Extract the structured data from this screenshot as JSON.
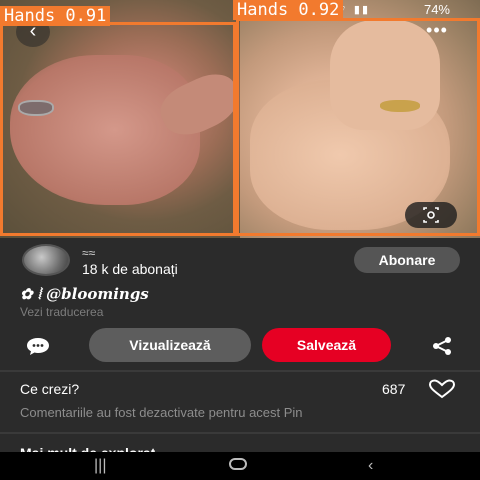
{
  "status": {
    "battery": "74%"
  },
  "detections": [
    {
      "label": "Hands 0.91"
    },
    {
      "label": "Hands 0.92"
    }
  ],
  "profile": {
    "name": "≈≈",
    "subscribers": "18 k de abonați",
    "subscribe_label": "Abonare"
  },
  "pin": {
    "handle": "✿ ⦚ @bloomings",
    "translate": "Vezi traducerea"
  },
  "actions": {
    "view_label": "Vizualizează",
    "save_label": "Salvează"
  },
  "engagement": {
    "prompt": "Ce crezi?",
    "likes": "687",
    "comments_disabled": "Comentariile au fost dezactivate pentru acest Pin",
    "more_to_explore": "Mai mult de explorat"
  },
  "colors": {
    "accent": "#e60023",
    "detection": "#f27a2e",
    "background": "#2b2b2b"
  },
  "icons": [
    "back-icon",
    "more-options-icon",
    "visual-search-icon",
    "comment-icon",
    "share-icon",
    "heart-icon"
  ]
}
